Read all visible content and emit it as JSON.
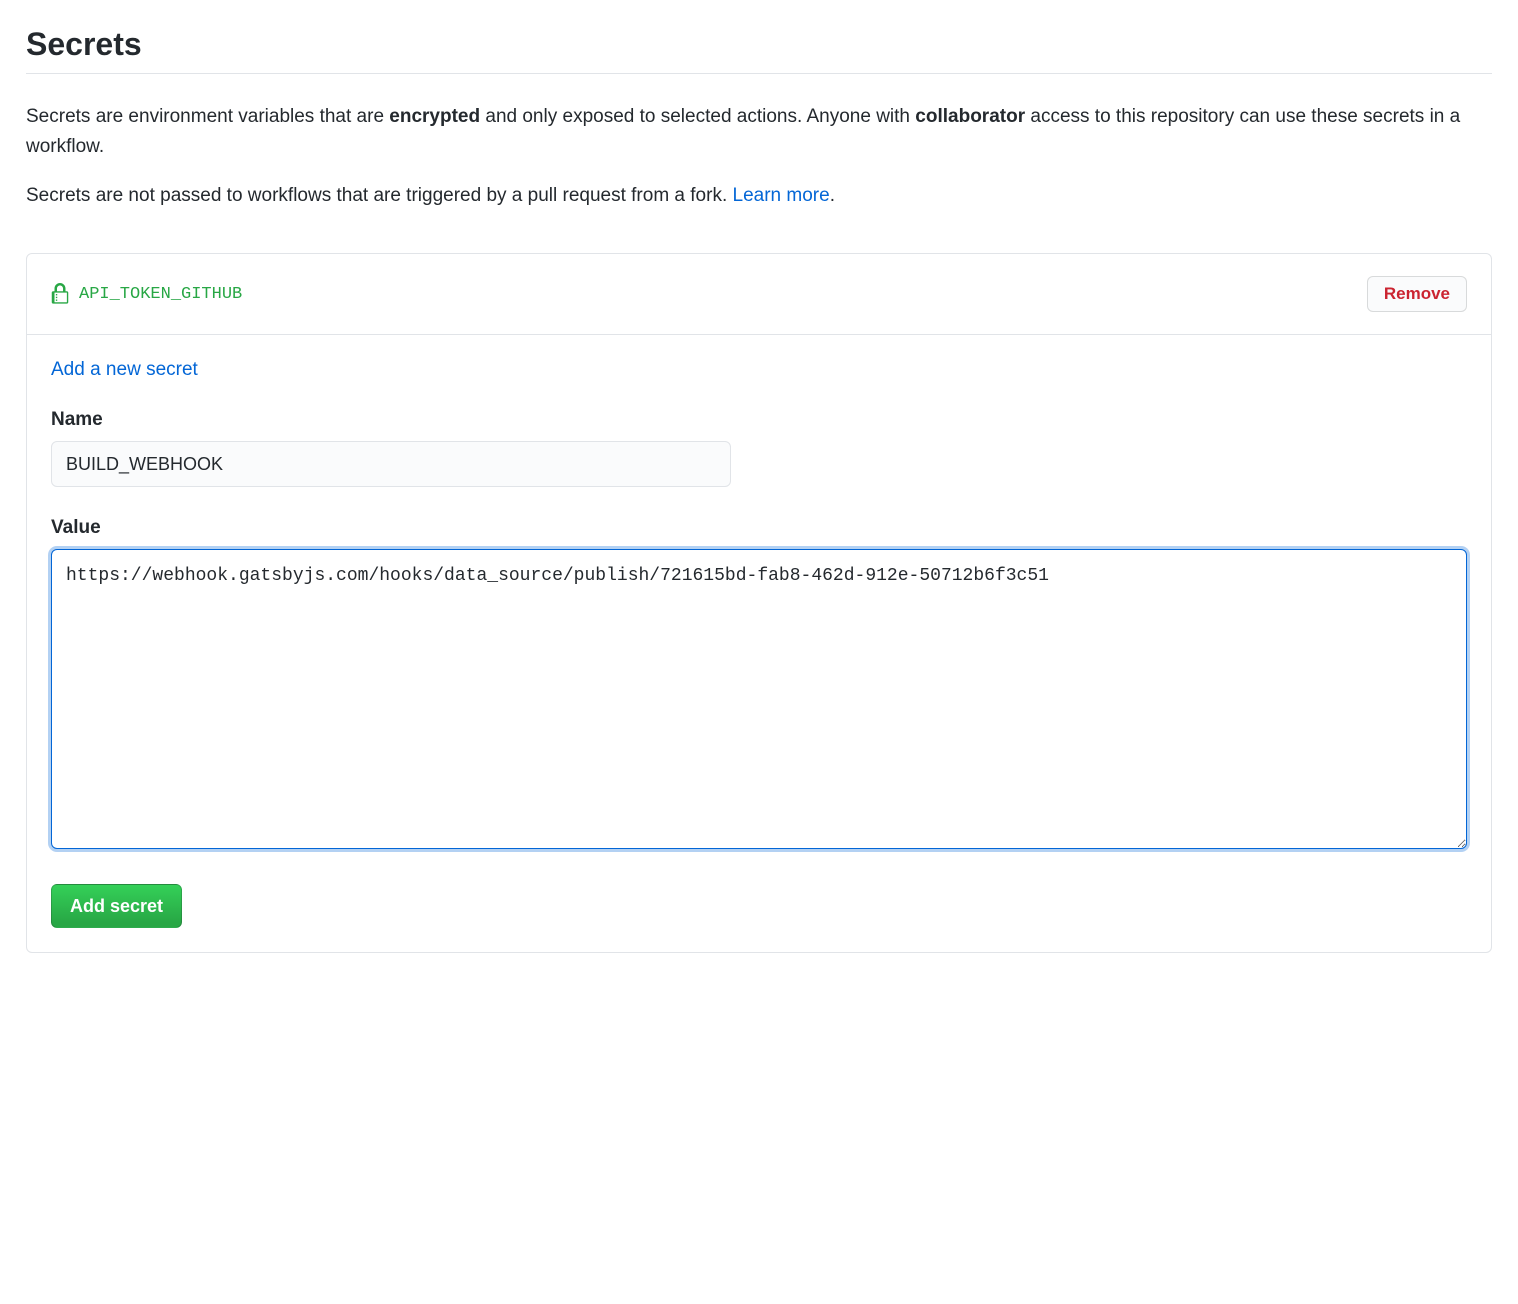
{
  "page": {
    "title": "Secrets"
  },
  "description": {
    "part1": "Secrets are environment variables that are ",
    "bold1": "encrypted",
    "part2": " and only exposed to selected actions. Anyone with ",
    "bold2": "collaborator",
    "part3": " access to this repository can use these secrets in a workflow."
  },
  "fork_note": {
    "text": "Secrets are not passed to workflows that are triggered by a pull request from a fork. ",
    "link_label": "Learn more",
    "period": "."
  },
  "secrets": [
    {
      "name": "API_TOKEN_GITHUB",
      "remove_label": "Remove"
    }
  ],
  "form": {
    "add_link_label": "Add a new secret",
    "name_label": "Name",
    "name_value": "BUILD_WEBHOOK",
    "value_label": "Value",
    "value_value": "https://webhook.gatsbyjs.com/hooks/data_source/publish/721615bd-fab8-462d-912e-50712b6f3c51",
    "submit_label": "Add secret"
  },
  "colors": {
    "link": "#0366d6",
    "success": "#28a745",
    "danger": "#cb2431",
    "border": "#e1e4e8"
  }
}
